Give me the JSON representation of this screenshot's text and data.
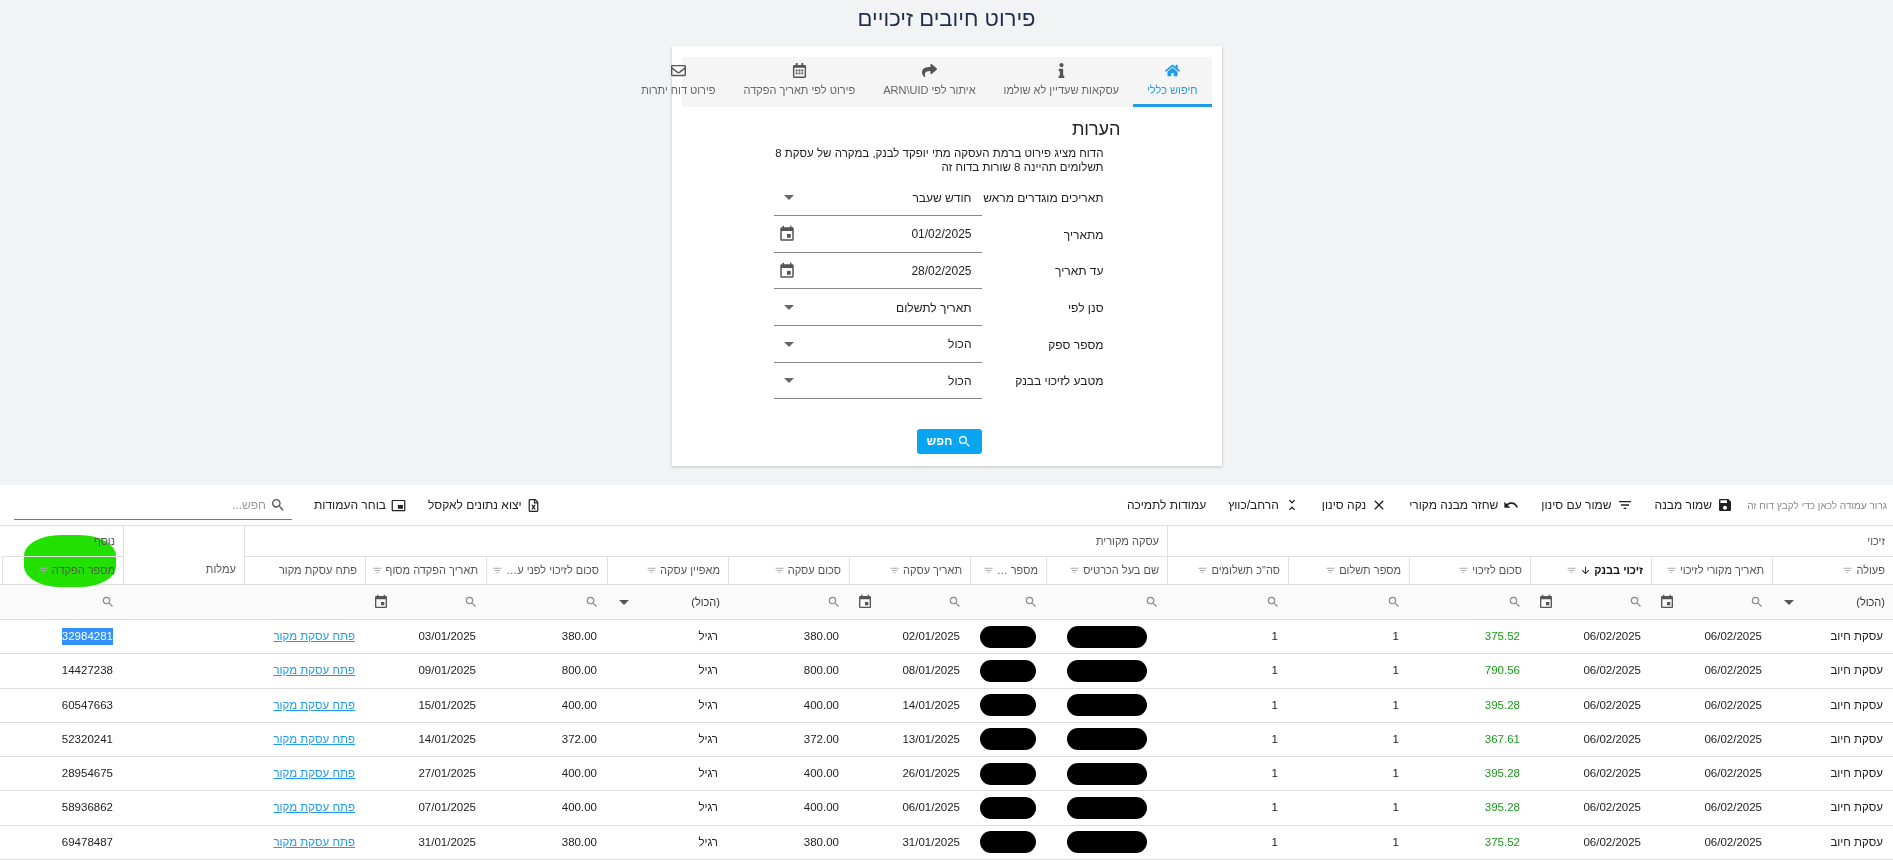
{
  "page_title": "פירוט חיובים זיכויים",
  "tabs": [
    {
      "label": "חיפוש כללי",
      "selected": true
    },
    {
      "label": "עסקאות שעדיין לא שולמו",
      "selected": false
    },
    {
      "label": "איתור לפי ARN\\UID",
      "selected": false
    },
    {
      "label": "פירוט לפי תאריך הפקדה",
      "selected": false
    },
    {
      "label": "פירוט דוח יתרות",
      "selected": false
    }
  ],
  "notes": {
    "heading": "הערות",
    "text": "הדוח מציג פירוט ברמת העסקה מתי יופקד לבנק, במקרה של עסקת 8 תשלומים תהיינה 8 שורות בדוח זה"
  },
  "form_fields": [
    {
      "label": "תאריכים מוגדרים מראש",
      "kind": "select",
      "value": "חודש שעבר"
    },
    {
      "label": "מתאריך",
      "kind": "date",
      "value": "01/02/2025"
    },
    {
      "label": "עד תאריך",
      "kind": "date",
      "value": "28/02/2025"
    },
    {
      "label": "סנן לפי",
      "kind": "select",
      "value": "תאריך לתשלום"
    },
    {
      "label": "מספר ספק",
      "kind": "select",
      "value": "הכול"
    },
    {
      "label": "מטבע לזיכוי בבנק",
      "kind": "select",
      "value": "הכול"
    }
  ],
  "search_button": "חפש",
  "toolbar": {
    "group_hint": "גרור עמודה לכאן כדי לקבץ דוח זה",
    "buttons": [
      "שמור מבנה",
      "שמור עם סינון",
      "שחזר מבנה מקורי",
      "נקה סינון",
      "הרחב/כווץ",
      "עמודות לתמיכה"
    ],
    "export_button": "יצוא נתונים לאקסל",
    "column_chooser": "בוחר העמודות",
    "search": {
      "placeholder": "חפש..."
    }
  },
  "table": {
    "groups": [
      "זיכוי",
      "עסקה מקורית",
      "נוסף"
    ],
    "columns": [
      {
        "label": "פעולה",
        "sorted": false,
        "filterable": true,
        "filter": {
          "kind": "select",
          "value": "(הכול)"
        }
      },
      {
        "label": "תאריך מקורי לזיכוי",
        "sorted": false,
        "filterable": true,
        "filter": {
          "kind": "date"
        }
      },
      {
        "label": "זיכוי בבנק",
        "sorted": true,
        "filterable": true,
        "filter": {
          "kind": "date"
        }
      },
      {
        "label": "סכום לזיכוי",
        "sorted": false,
        "filterable": true,
        "filter": {
          "kind": "text"
        }
      },
      {
        "label": "מספר תשלום",
        "sorted": false,
        "filterable": true,
        "filter": {
          "kind": "text"
        }
      },
      {
        "label": "סה\"כ תשלומים",
        "sorted": false,
        "filterable": true,
        "filter": {
          "kind": "text"
        }
      },
      {
        "label": "שם בעל הכרטיס",
        "sorted": false,
        "filterable": true,
        "filter": {
          "kind": "text"
        }
      },
      {
        "label": "מספר …",
        "sorted": false,
        "filterable": true,
        "filter": {
          "kind": "text"
        }
      },
      {
        "label": "תאריך עסקה",
        "sorted": false,
        "filterable": true,
        "filter": {
          "kind": "date"
        }
      },
      {
        "label": "סכום עסקה",
        "sorted": false,
        "filterable": true,
        "filter": {
          "kind": "text"
        }
      },
      {
        "label": "מאפיין עסקה",
        "sorted": false,
        "filterable": true,
        "filter": {
          "kind": "select",
          "value": "(הכול)"
        }
      },
      {
        "label": "סכום לזיכוי לפני ע…",
        "sorted": false,
        "filterable": true,
        "filter": {
          "kind": "text"
        }
      },
      {
        "label": "תאריך הפקדה מסוף",
        "sorted": false,
        "filterable": true,
        "filter": {
          "kind": "date"
        }
      },
      {
        "label": "פתח עסקת מקור",
        "sorted": false,
        "filterable": false,
        "filter": {
          "kind": "none"
        }
      },
      {
        "label": "עמלות",
        "sorted": false,
        "filterable": false,
        "filter": {
          "kind": "none"
        }
      },
      {
        "label": "מספר הפקדה",
        "sorted": false,
        "filterable": true,
        "filter": {
          "kind": "text"
        }
      }
    ],
    "rows": [
      {
        "action": "עסקת חיוב",
        "original_credit_date": "06/02/2025",
        "bank_credit_date": "06/02/2025",
        "credit_amount": "375.52",
        "payment_number": "1",
        "total_payments": "1",
        "cardholder_redacted": true,
        "column_8_redacted": true,
        "transaction_date": "02/01/2025",
        "transaction_amount": "380.00",
        "transaction_type": "רגיל",
        "credit_before_fees": "380.00",
        "terminal_deposit_date": "03/01/2025",
        "source_link": "פתח עסקת מקור",
        "deposit_number": "32984281",
        "deposit_number_selected": true
      },
      {
        "action": "עסקת חיוב",
        "original_credit_date": "06/02/2025",
        "bank_credit_date": "06/02/2025",
        "credit_amount": "790.56",
        "payment_number": "1",
        "total_payments": "1",
        "cardholder_redacted": true,
        "column_8_redacted": true,
        "transaction_date": "08/01/2025",
        "transaction_amount": "800.00",
        "transaction_type": "רגיל",
        "credit_before_fees": "800.00",
        "terminal_deposit_date": "09/01/2025",
        "source_link": "פתח עסקת מקור",
        "deposit_number": "14427238",
        "deposit_number_selected": false
      },
      {
        "action": "עסקת חיוב",
        "original_credit_date": "06/02/2025",
        "bank_credit_date": "06/02/2025",
        "credit_amount": "395.28",
        "payment_number": "1",
        "total_payments": "1",
        "cardholder_redacted": true,
        "column_8_redacted": true,
        "transaction_date": "14/01/2025",
        "transaction_amount": "400.00",
        "transaction_type": "רגיל",
        "credit_before_fees": "400.00",
        "terminal_deposit_date": "15/01/2025",
        "source_link": "פתח עסקת מקור",
        "deposit_number": "60547663",
        "deposit_number_selected": false
      },
      {
        "action": "עסקת חיוב",
        "original_credit_date": "06/02/2025",
        "bank_credit_date": "06/02/2025",
        "credit_amount": "367.61",
        "payment_number": "1",
        "total_payments": "1",
        "cardholder_redacted": true,
        "column_8_redacted": true,
        "transaction_date": "13/01/2025",
        "transaction_amount": "372.00",
        "transaction_type": "רגיל",
        "credit_before_fees": "372.00",
        "terminal_deposit_date": "14/01/2025",
        "source_link": "פתח עסקת מקור",
        "deposit_number": "52320241",
        "deposit_number_selected": false
      },
      {
        "action": "עסקת חיוב",
        "original_credit_date": "06/02/2025",
        "bank_credit_date": "06/02/2025",
        "credit_amount": "395.28",
        "payment_number": "1",
        "total_payments": "1",
        "cardholder_redacted": true,
        "column_8_redacted": true,
        "transaction_date": "26/01/2025",
        "transaction_amount": "400.00",
        "transaction_type": "רגיל",
        "credit_before_fees": "400.00",
        "terminal_deposit_date": "27/01/2025",
        "source_link": "פתח עסקת מקור",
        "deposit_number": "28954675",
        "deposit_number_selected": false
      },
      {
        "action": "עסקת חיוב",
        "original_credit_date": "06/02/2025",
        "bank_credit_date": "06/02/2025",
        "credit_amount": "395.28",
        "payment_number": "1",
        "total_payments": "1",
        "cardholder_redacted": true,
        "column_8_redacted": true,
        "transaction_date": "06/01/2025",
        "transaction_amount": "400.00",
        "transaction_type": "רגיל",
        "credit_before_fees": "400.00",
        "terminal_deposit_date": "07/01/2025",
        "source_link": "פתח עסקת מקור",
        "deposit_number": "58936862",
        "deposit_number_selected": false
      },
      {
        "action": "עסקת חיוב",
        "original_credit_date": "06/02/2025",
        "bank_credit_date": "06/02/2025",
        "credit_amount": "375.52",
        "payment_number": "1",
        "total_payments": "1",
        "cardholder_redacted": true,
        "column_8_redacted": true,
        "transaction_date": "31/01/2025",
        "transaction_amount": "380.00",
        "transaction_type": "רגיל",
        "credit_before_fees": "380.00",
        "terminal_deposit_date": "31/01/2025",
        "source_link": "פתח עסקת מקור",
        "deposit_number": "69478487",
        "deposit_number_selected": false
      }
    ]
  }
}
